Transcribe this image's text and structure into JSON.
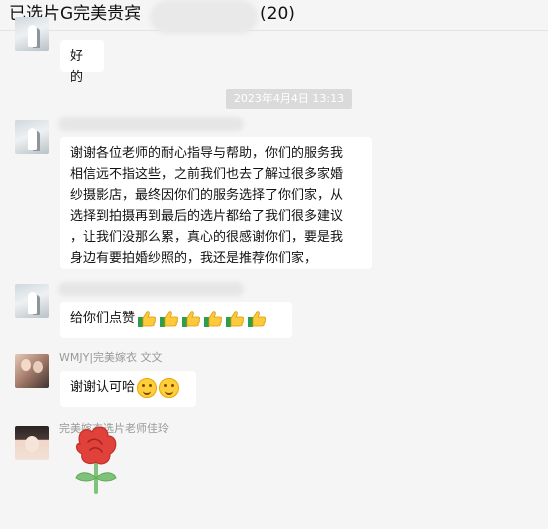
{
  "header": {
    "title": "已选片G完美贵宾",
    "count": "(20)"
  },
  "messages": [
    {
      "text": "好的"
    },
    {
      "timestamp": "2023年4月4日 13:13"
    },
    {
      "text": "谢谢各位老师的耐心指导与帮助，你们的服务我相信远不指这些，之前我们也去了解过很多家婚纱摄影店，最终因你们的服务选择了你们家，从选择到拍摄再到最后的选片都给了我们很多建议，让我们没那么累，真心的很感谢你们，要是我身边有要拍婚纱照的，我还是推荐你们家，",
      "lines": [
        "谢谢各位老师的耐心指导与帮助，你们的服务我",
        "相信远不指这些，之前我们也去了解过很多家婚",
        "纱摄影店，最终因你们的服务选择了你们家，从",
        "选择到拍摄再到最后的选片都给了我们很多建议",
        "，让我们没那么累，真心的很感谢你们，要是我",
        "身边有要拍婚纱照的，我还是推荐你们家，"
      ]
    },
    {
      "text": "给你们点赞",
      "emoji": "thumbs-up",
      "emoji_count": 6
    },
    {
      "sender": "WMJY|完美嫁衣  文文",
      "text": "谢谢认可哈",
      "emoji": "smile",
      "emoji_count": 2
    },
    {
      "sender": "完美嫁衣选片老师佳玲",
      "sticker": "red-flower"
    }
  ],
  "colors": {
    "background": "#f5f5f5",
    "bubble": "#ffffff",
    "timestamp_bg": "#dadada",
    "sticker_red": "#e0413a",
    "sticker_green": "#7fc37a"
  }
}
